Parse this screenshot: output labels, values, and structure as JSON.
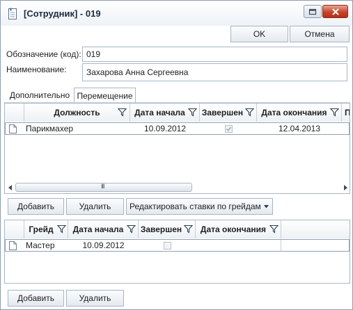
{
  "window": {
    "title": "[Сотрудник] - 019",
    "minimize_icon": "restore-icon",
    "close_icon": "close-icon"
  },
  "toolbar": {
    "ok_label": "OK",
    "cancel_label": "Отмена"
  },
  "form": {
    "code_label": "Обозначение (код):",
    "code_value": "019",
    "name_label": "Наименование:",
    "name_value": "Захарова Анна Сергеевна"
  },
  "tabs": [
    {
      "label": "Дополнительно",
      "active": false
    },
    {
      "label": "Перемещение",
      "active": true
    }
  ],
  "positions_grid": {
    "columns": [
      "Должность",
      "Дата начала",
      "Завершен",
      "Дата окончания",
      "П"
    ],
    "rows": [
      {
        "position": "Парикмахер",
        "start_date": "10.09.2012",
        "completed": true,
        "end_date": "12.04.2013"
      }
    ],
    "scrollbar_thumb_label": "III"
  },
  "positions_actions": {
    "add_label": "Добавить",
    "delete_label": "Удалить",
    "edit_rates_label": "Редактировать ставки по грейдам"
  },
  "grades_grid": {
    "columns": [
      "Грейд",
      "Дата начала",
      "Завершен",
      "Дата окончания"
    ],
    "rows": [
      {
        "grade": "Мастер",
        "start_date": "10.09.2012",
        "completed": false,
        "end_date": ""
      }
    ]
  },
  "grades_actions": {
    "add_label": "Добавить",
    "delete_label": "Удалить"
  },
  "colors": {
    "border": "#a9b6c7",
    "accent": "#1b2a3d",
    "close": "#c9442b"
  }
}
